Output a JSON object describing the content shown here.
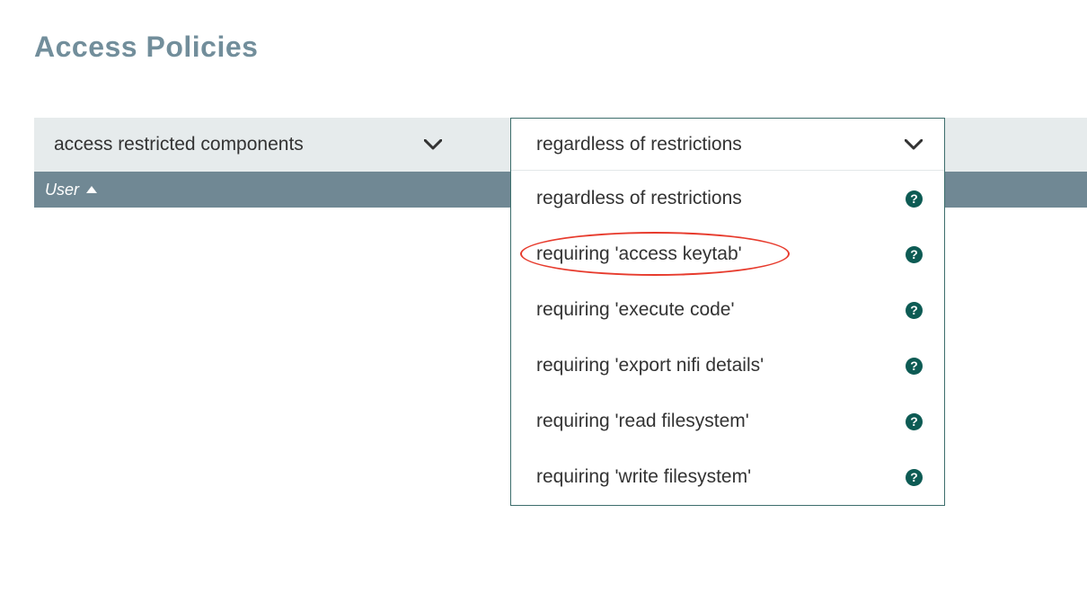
{
  "title": "Access Policies",
  "policy_select": {
    "label": "access restricted components"
  },
  "table_header": {
    "user": "User"
  },
  "restriction_dropdown": {
    "selected": "regardless of restrictions",
    "options": [
      {
        "label": "regardless of restrictions"
      },
      {
        "label": "requiring 'access keytab'"
      },
      {
        "label": "requiring 'execute code'"
      },
      {
        "label": "requiring 'export nifi details'"
      },
      {
        "label": "requiring 'read filesystem'"
      },
      {
        "label": "requiring 'write filesystem'"
      }
    ],
    "highlighted_index": 1
  },
  "colors": {
    "heading": "#728e9b",
    "grey_bar": "#e6ebec",
    "dark_bar": "#708894",
    "border": "#3d6e6c",
    "help_bg": "#0d5b54",
    "annotation": "#e73b2d"
  }
}
